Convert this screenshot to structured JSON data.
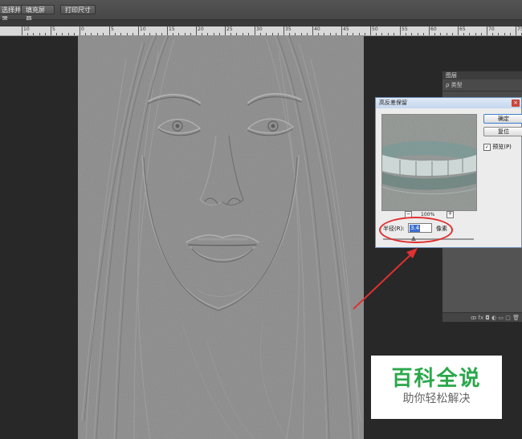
{
  "toolbar": {
    "buttons": [
      "选择并遮罩",
      "填充屏幕",
      "打印尺寸"
    ]
  },
  "ruler": {
    "labels": [
      "10",
      "5",
      "0",
      "5",
      "10",
      "15",
      "20",
      "25",
      "30",
      "35",
      "40",
      "45",
      "50",
      "55",
      "60",
      "65",
      "70",
      "75"
    ]
  },
  "layers_panel": {
    "title": "图层",
    "filter_label": "ρ 类型",
    "footer_icons": "ꝏ fx ◘ ◐ ▭ ▢ 🗑"
  },
  "dialog": {
    "title": "高反差保留",
    "close": "×",
    "ok_label": "确定",
    "reset_label": "复位",
    "preview_label": "预览(P)",
    "preview_checked_mark": "✓",
    "zoom_minus": "−",
    "zoom_plus": "+",
    "zoom_level": "100%",
    "radius_label": "半径(R):",
    "radius_value": "3.4",
    "radius_unit": "像素",
    "slider_value_fraction": 0.34
  },
  "watermark": {
    "title": "百科全说",
    "subtitle": "助你轻松解决"
  },
  "colors": {
    "annotation": "#e03030",
    "watermark_green": "#2aa84a",
    "selection_blue": "#3d6fd1"
  }
}
